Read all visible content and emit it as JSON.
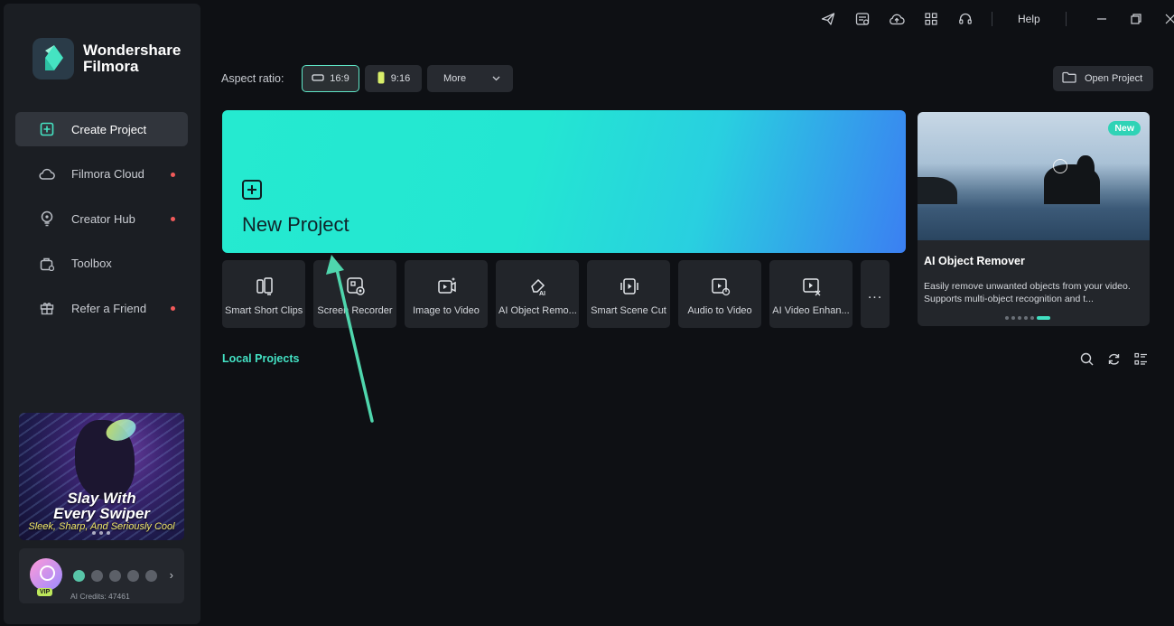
{
  "app": {
    "brand_line1": "Wondershare",
    "brand_line2": "Filmora"
  },
  "sidebar": {
    "items": [
      {
        "label": "Create Project",
        "icon": "create-project-icon",
        "active": true,
        "dot": false
      },
      {
        "label": "Filmora Cloud",
        "icon": "cloud-icon",
        "active": false,
        "dot": true
      },
      {
        "label": "Creator Hub",
        "icon": "bulb-icon",
        "active": false,
        "dot": true
      },
      {
        "label": "Toolbox",
        "icon": "toolbox-icon",
        "active": false,
        "dot": false
      },
      {
        "label": "Refer a Friend",
        "icon": "gift-icon",
        "active": false,
        "dot": true
      }
    ],
    "promo": {
      "title_line1": "Slay With",
      "title_line2": "Every Swiper",
      "subtitle": "Sleek, Sharp, And Seriously Cool"
    },
    "account": {
      "badge": "VIP",
      "credits": "AI Credits: 47461"
    }
  },
  "titlebar": {
    "icons": [
      "send-icon",
      "task-list-icon",
      "cloud-upload-icon",
      "grid-apps-icon",
      "headset-icon"
    ],
    "help": "Help"
  },
  "aspect": {
    "label": "Aspect ratio:",
    "options": [
      "16:9",
      "9:16"
    ],
    "selected": "16:9",
    "more": "More"
  },
  "open_project": "Open Project",
  "new_project": {
    "label": "New Project"
  },
  "tools": [
    {
      "label": "Smart Short Clips",
      "icon": "smart-short-clips-icon"
    },
    {
      "label": "Screen Recorder",
      "icon": "screen-recorder-icon"
    },
    {
      "label": "Image to Video",
      "icon": "image-to-video-icon"
    },
    {
      "label": "AI Object Remo...",
      "icon": "ai-object-remover-icon"
    },
    {
      "label": "Smart Scene Cut",
      "icon": "smart-scene-cut-icon"
    },
    {
      "label": "Audio to Video",
      "icon": "audio-to-video-icon"
    },
    {
      "label": "AI Video Enhan...",
      "icon": "ai-video-enhancer-icon"
    }
  ],
  "tools_more": "...",
  "feature": {
    "badge": "New",
    "title": "AI Object Remover",
    "description": "Easily remove unwanted objects from your video. Supports multi-object recognition and t...",
    "pages": 6,
    "current_page": 6
  },
  "local_projects": {
    "title": "Local Projects"
  },
  "colors": {
    "accent": "#43e2c4",
    "notification_dot": "#f25a5a",
    "new_project_gradient_start": "#25ead0",
    "new_project_gradient_end": "#3b7ff2"
  }
}
